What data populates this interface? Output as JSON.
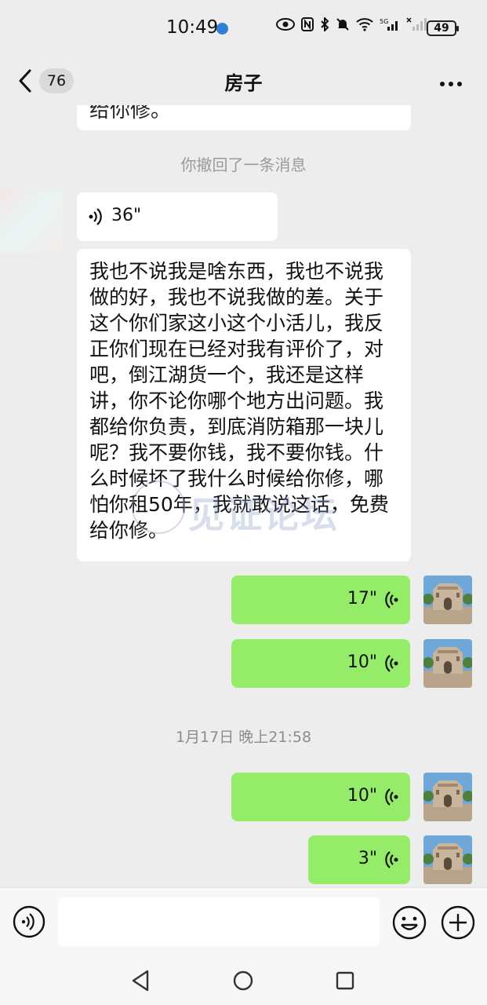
{
  "status_bar": {
    "time": "10:49",
    "battery": "49",
    "icons": [
      "eye-icon",
      "nfc-icon",
      "bluetooth-icon",
      "mute-icon",
      "wifi-icon",
      "signal-5g-icon",
      "signal-icon"
    ],
    "network_label": "5G"
  },
  "header": {
    "unread_count": "76",
    "title": "房子"
  },
  "messages": {
    "partial_text": "给你修。",
    "recall_notice": "你撤回了一条消息",
    "incoming_voice_duration": "36\"",
    "long_message": "我也不说我是啥东西，我也不说我做的好，我也不说我做的差。关于这个你们家这小这个小活儿，我反正你们现在已经对我有评价了，对吧，倒江湖货一个，我还是这样讲，你不论你哪个地方出问题。我都给你负责，到底消防箱那一块儿呢？我不要你钱，我不要你钱。什么时候坏了我什么时候给你修，哪怕你租50年，我就敢说这话，免费给你修。",
    "watermark": "见证论坛",
    "outgoing_voice_1": "17\"",
    "outgoing_voice_2": "10\"",
    "timestamp": "1月17日 晚上21:58",
    "outgoing_voice_3": "10\"",
    "outgoing_voice_4": "3\""
  },
  "colors": {
    "background": "#ededed",
    "outgoing_bubble": "#95ec69",
    "incoming_bubble": "#ffffff"
  }
}
